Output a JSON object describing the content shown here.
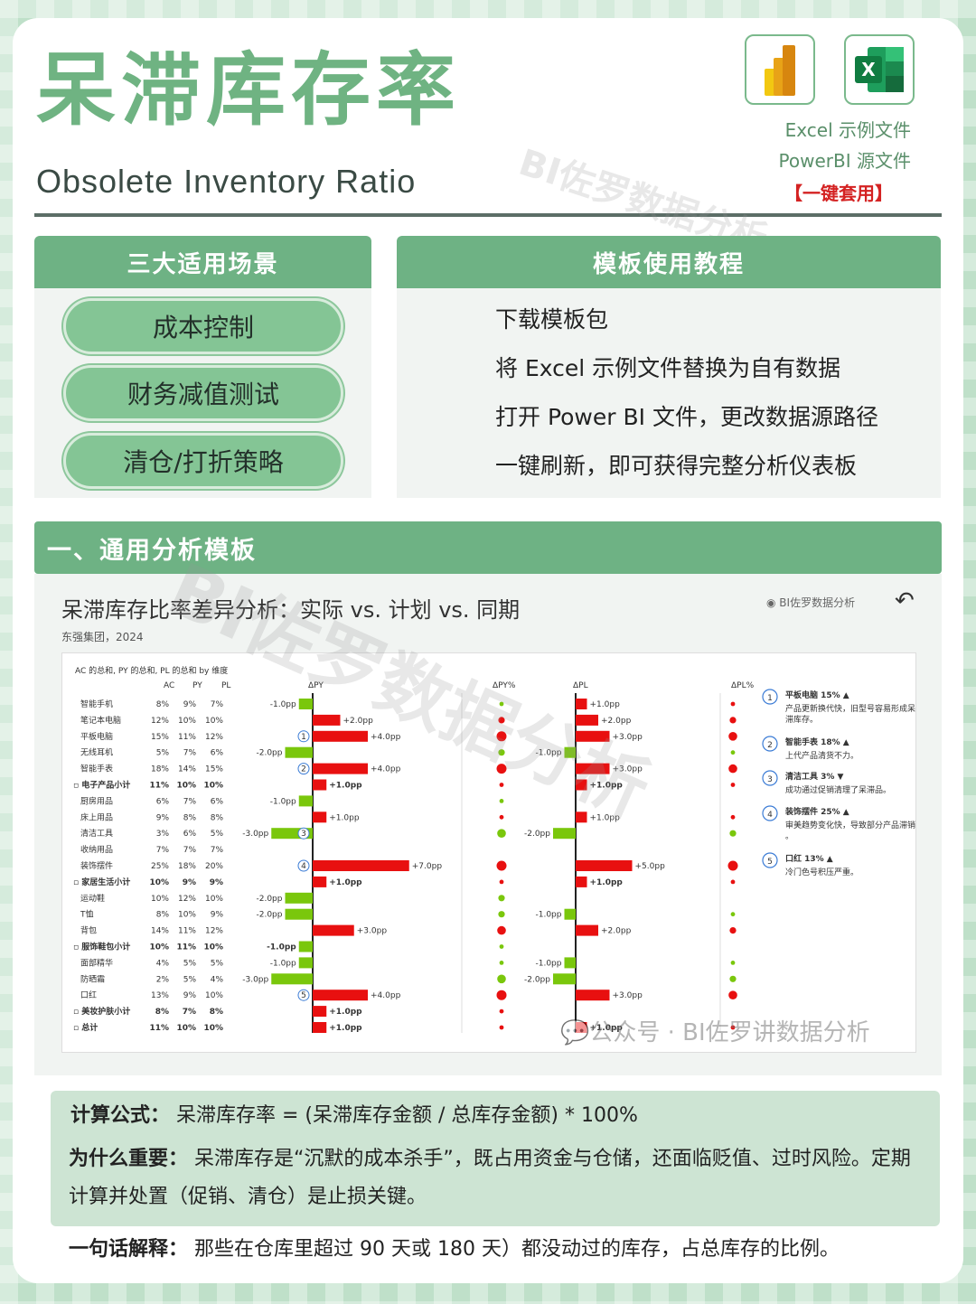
{
  "header": {
    "title_cn": "呆滞库存率",
    "title_en": "Obsolete Inventory Ratio",
    "file_excel": "Excel 示例文件",
    "file_pbi": "PowerBI 源文件",
    "one_click": "【一键套用】",
    "watermark": "BI佐罗数据分析"
  },
  "scenarios": {
    "heading": "三大适用场景",
    "items": [
      "成本控制",
      "财务减值测试",
      "清仓/打折策略"
    ]
  },
  "tutorial": {
    "heading": "模板使用教程",
    "steps": [
      "下载模板包",
      "将 Excel 示例文件替换为自有数据",
      "打开 Power BI 文件，更改数据源路径",
      "一键刷新，即可获得完整分析仪表板"
    ]
  },
  "section1": {
    "heading": "一、通用分析模板"
  },
  "dashboard": {
    "title": "呆滞库存比率差异分析：实际 vs. 计划 vs. 同期",
    "subtitle": "东强集团，2024",
    "brand": "BI佐罗数据分析",
    "chart_caption": "AC 的总和, PY 的总和, PL 的总和 by 维度",
    "wechat": "公众号 · BI佐罗讲数据分析"
  },
  "chart_data": {
    "type": "table",
    "columns": [
      "AC",
      "PY",
      "PL",
      "ΔPY",
      "ΔPY%",
      "ΔPL",
      "ΔPL%"
    ],
    "rows": [
      {
        "name": "智能手机",
        "ac": "8%",
        "py": "9%",
        "pl": "7%",
        "dpy": -1.0,
        "dpl": 1.0
      },
      {
        "name": "笔记本电脑",
        "ac": "12%",
        "py": "10%",
        "pl": "10%",
        "dpy": 2.0,
        "dpl": 2.0
      },
      {
        "name": "平板电脑",
        "ac": "15%",
        "py": "11%",
        "pl": "12%",
        "dpy": 4.0,
        "dpl": 3.0,
        "mark": "1"
      },
      {
        "name": "无线耳机",
        "ac": "5%",
        "py": "7%",
        "pl": "6%",
        "dpy": -2.0,
        "dpl": -1.0
      },
      {
        "name": "智能手表",
        "ac": "18%",
        "py": "14%",
        "pl": "15%",
        "dpy": 4.0,
        "dpl": 3.0,
        "mark": "2"
      },
      {
        "name": "电子产品小计",
        "ac": "11%",
        "py": "10%",
        "pl": "10%",
        "dpy": 1.0,
        "dpl": 1.0,
        "bold": true
      },
      {
        "name": "厨房用品",
        "ac": "6%",
        "py": "7%",
        "pl": "6%",
        "dpy": -1.0,
        "dpl": 0
      },
      {
        "name": "床上用品",
        "ac": "9%",
        "py": "8%",
        "pl": "8%",
        "dpy": 1.0,
        "dpl": 1.0
      },
      {
        "name": "清洁工具",
        "ac": "3%",
        "py": "6%",
        "pl": "5%",
        "dpy": -3.0,
        "dpl": -2.0,
        "mark": "3"
      },
      {
        "name": "收纳用品",
        "ac": "7%",
        "py": "7%",
        "pl": "7%",
        "dpy": 0,
        "dpl": 0
      },
      {
        "name": "装饰摆件",
        "ac": "25%",
        "py": "18%",
        "pl": "20%",
        "dpy": 7.0,
        "dpl": 5.0,
        "mark": "4"
      },
      {
        "name": "家居生活小计",
        "ac": "10%",
        "py": "9%",
        "pl": "9%",
        "dpy": 1.0,
        "dpl": 1.0,
        "bold": true
      },
      {
        "name": "运动鞋",
        "ac": "10%",
        "py": "12%",
        "pl": "10%",
        "dpy": -2.0,
        "dpl": 0
      },
      {
        "name": "T恤",
        "ac": "8%",
        "py": "10%",
        "pl": "9%",
        "dpy": -2.0,
        "dpl": -1.0
      },
      {
        "name": "背包",
        "ac": "14%",
        "py": "11%",
        "pl": "12%",
        "dpy": 3.0,
        "dpl": 2.0
      },
      {
        "name": "服饰鞋包小计",
        "ac": "10%",
        "py": "11%",
        "pl": "10%",
        "dpy": -1.0,
        "dpl": 0,
        "bold": true
      },
      {
        "name": "面部精华",
        "ac": "4%",
        "py": "5%",
        "pl": "5%",
        "dpy": -1.0,
        "dpl": -1.0
      },
      {
        "name": "防晒霜",
        "ac": "2%",
        "py": "5%",
        "pl": "4%",
        "dpy": -3.0,
        "dpl": -2.0
      },
      {
        "name": "口红",
        "ac": "13%",
        "py": "9%",
        "pl": "10%",
        "dpy": 4.0,
        "dpl": 3.0,
        "mark": "5"
      },
      {
        "name": "美妆护肤小计",
        "ac": "8%",
        "py": "7%",
        "pl": "8%",
        "dpy": 1.0,
        "dpl": 0,
        "bold": true
      },
      {
        "name": "总计",
        "ac": "11%",
        "py": "10%",
        "pl": "10%",
        "dpy": 1.0,
        "dpl": 1.0,
        "bold": true
      }
    ],
    "colors": {
      "positive": "#e81010",
      "negative": "#7ac70c"
    }
  },
  "notes": [
    {
      "num": "1",
      "title": "平板电脑 15%",
      "trend": "up",
      "text": "产品更新换代快，旧型号容易形成呆滞库存。"
    },
    {
      "num": "2",
      "title": "智能手表 18%",
      "trend": "up",
      "text": "上代产品清货不力。"
    },
    {
      "num": "3",
      "title": "清洁工具 3%",
      "trend": "down",
      "text": "成功通过促销清理了呆滞品。"
    },
    {
      "num": "4",
      "title": "装饰摆件 25%",
      "trend": "up",
      "text": "审美趋势变化快，导致部分产品滞销。"
    },
    {
      "num": "5",
      "title": "口红 13%",
      "trend": "up",
      "text": "冷门色号积压严重。"
    }
  ],
  "formula": {
    "label1": "计算公式：",
    "text1": "呆滞库存率 = (呆滞库存金额 / 总库存金额) * 100%",
    "label2": "为什么重要：",
    "text2": "呆滞库存是“沉默的成本杀手”，既占用资金与仓储，还面临贬值、过时风险。定期计算并处置（促销、清仓）是止损关键。",
    "label3": "一句话解释：",
    "text3": "那些在仓库里超过 90 天或 180 天）都没动过的库存，占总库存的比例。"
  }
}
